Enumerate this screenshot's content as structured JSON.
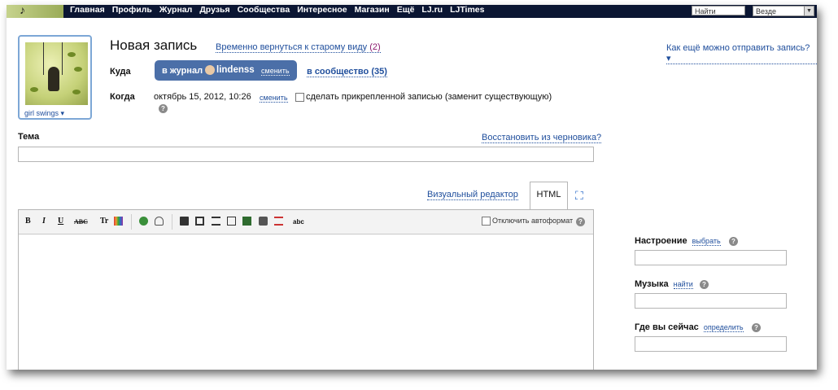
{
  "nav": {
    "items": [
      "Главная",
      "Профиль",
      "Журнал",
      "Друзья",
      "Сообщества",
      "Интересное",
      "Магазин",
      "Ещё",
      "LJ.ru",
      "LJTimes"
    ],
    "search_placeholder": "Найти",
    "scope_value": "Везде"
  },
  "userpic": {
    "label": "girl swings"
  },
  "header": {
    "title": "Новая запись",
    "old_view_link": "Временно вернуться к старому виду",
    "old_view_count": "(2)",
    "how_else_link": "Как ещё можно отправить запись?"
  },
  "where": {
    "label": "Куда",
    "journal_prefix": "в журнал",
    "username": "lindenss",
    "change": "сменить",
    "community": "в сообщество (35)"
  },
  "when": {
    "label": "Когда",
    "date": "октябрь 15, 2012, 10:26",
    "change": "сменить",
    "sticky": "сделать прикрепленной записью (заменит существующую)"
  },
  "subject": {
    "label": "Тема",
    "restore": "Восстановить из черновика?"
  },
  "editor": {
    "tab_visual": "Визуальный редактор",
    "tab_html": "HTML",
    "autoformat": "Отключить автоформат",
    "toolbar": {
      "bold": "B",
      "italic": "I",
      "underline": "U",
      "strike": "ABC",
      "size": "Tr",
      "spell": "abc"
    }
  },
  "sidebar": {
    "mood": {
      "label": "Настроение",
      "action": "выбрать"
    },
    "music": {
      "label": "Музыка",
      "action": "найти"
    },
    "location": {
      "label": "Где вы сейчас",
      "action": "определить"
    }
  },
  "colors": {
    "accent": "#4b6fa8",
    "link": "#1f4e9c",
    "topbar": "#0b1633"
  }
}
